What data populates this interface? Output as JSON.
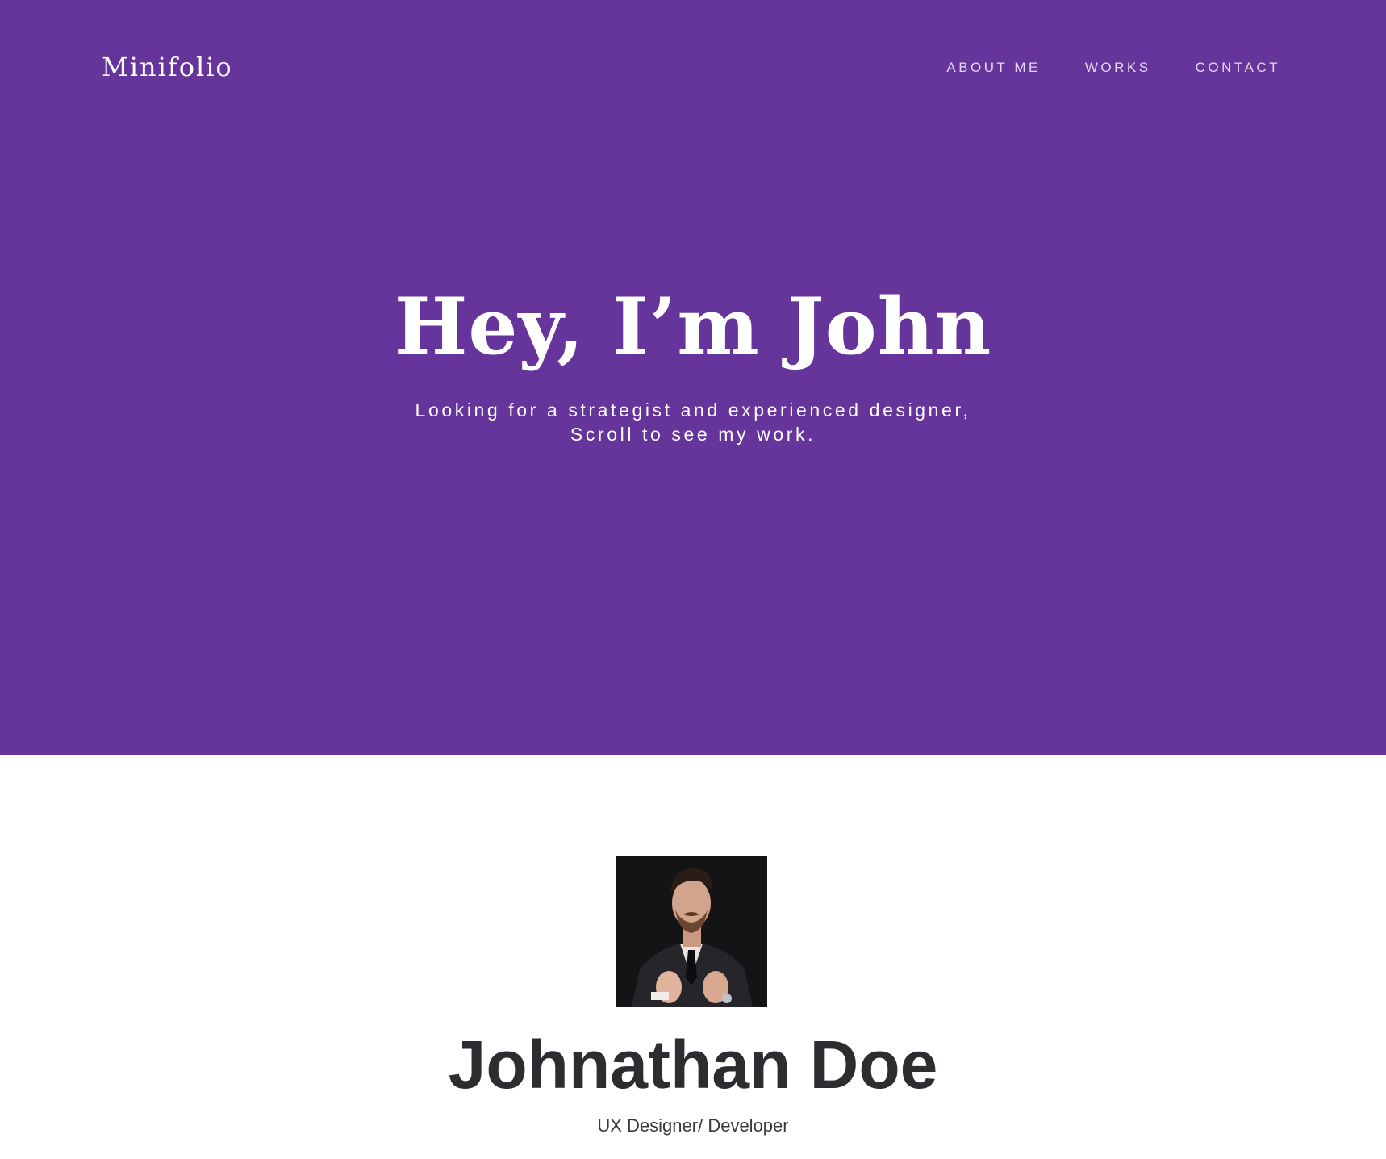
{
  "header": {
    "brand": "Minifolio",
    "nav": [
      "ABOUT ME",
      "WORKS",
      "CONTACT"
    ]
  },
  "hero": {
    "title": "Hey, I’m John",
    "subtitle_line1": "Looking for a strategist and experienced designer,",
    "subtitle_line2": "Scroll to see my work."
  },
  "profile": {
    "name": "Johnathan Doe",
    "role": "UX Designer/ Developer",
    "avatar_icon": "portrait-photo"
  },
  "colors": {
    "hero_background": "#66359c",
    "nav_text": "#e4d8f2",
    "name_text": "#2b2d30"
  }
}
